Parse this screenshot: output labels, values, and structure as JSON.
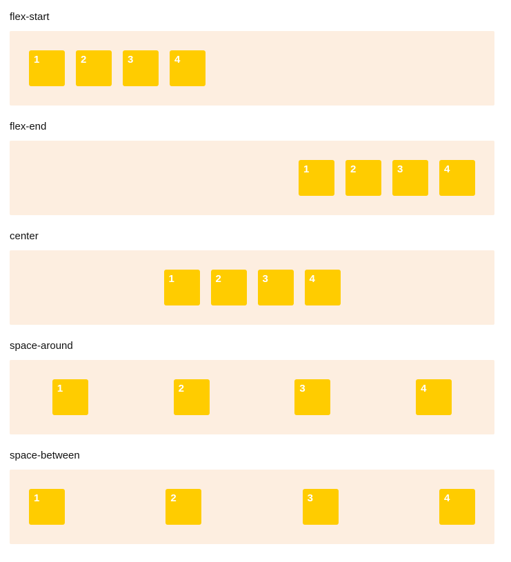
{
  "sections": [
    {
      "label": "flex-start",
      "items": [
        "1",
        "2",
        "3",
        "4"
      ]
    },
    {
      "label": "flex-end",
      "items": [
        "1",
        "2",
        "3",
        "4"
      ]
    },
    {
      "label": "center",
      "items": [
        "1",
        "2",
        "3",
        "4"
      ]
    },
    {
      "label": "space-around",
      "items": [
        "1",
        "2",
        "3",
        "4"
      ]
    },
    {
      "label": "space-between",
      "items": [
        "1",
        "2",
        "3",
        "4"
      ]
    }
  ],
  "colors": {
    "container_background": "#fdeee0",
    "item_background": "#ffcc00",
    "item_text": "#ffffff"
  }
}
